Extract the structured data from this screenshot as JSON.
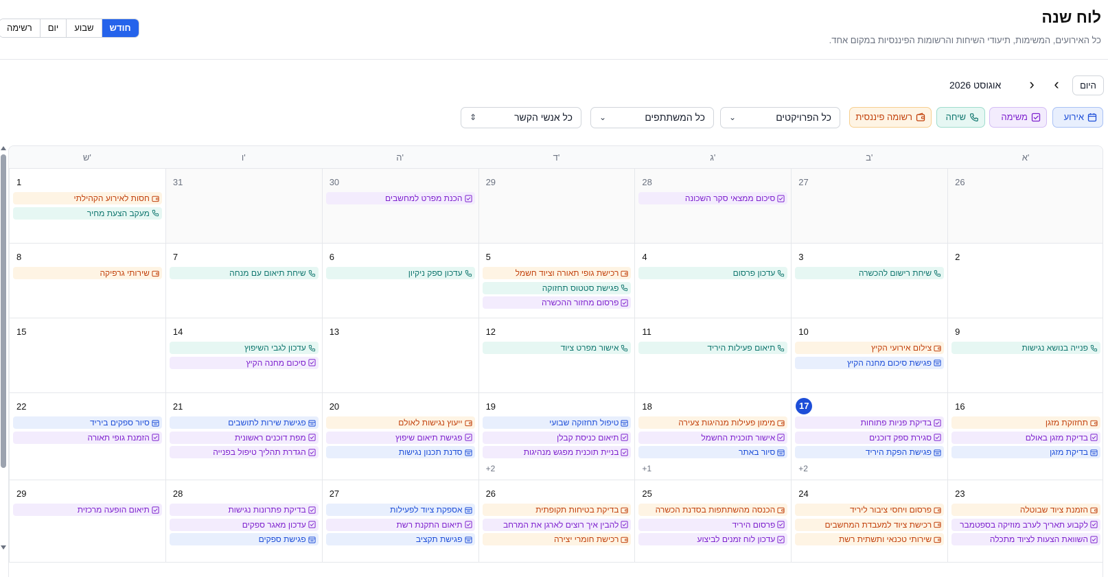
{
  "header": {
    "title": "לוח שנה",
    "subtitle": "כל האירועים, המשימות, תיעודי השיחות והרשומות הפיננסיות במקום אחד."
  },
  "views": [
    "חודש",
    "שבוע",
    "יום",
    "רשימה"
  ],
  "active_view": "חודש",
  "nav": {
    "today_label": "היום",
    "month_label": "אוגוסט 2026"
  },
  "types": {
    "event": "אירוע",
    "task": "משימה",
    "call": "שיחה",
    "fin": "רשומה פיננסית"
  },
  "filters": {
    "projects": "כל הפרויקטים",
    "participants": "כל המשתתפים",
    "contacts": "כל אנשי הקשר"
  },
  "weekdays": [
    "א'",
    "ב'",
    "ג'",
    "ד'",
    "ה'",
    "ו'",
    "ש'"
  ],
  "colors": {
    "event": "#1d4ed8",
    "task": "#7e22ce",
    "call": "#0f766e",
    "fin": "#c2410c",
    "accent": "#2563eb"
  },
  "today": "17",
  "weeks": [
    [
      {
        "day": "26",
        "other": true,
        "events": []
      },
      {
        "day": "27",
        "other": true,
        "events": []
      },
      {
        "day": "28",
        "other": true,
        "events": [
          {
            "t": "task",
            "label": "סיכום ממצאי סקר השכונה"
          }
        ]
      },
      {
        "day": "29",
        "other": true,
        "events": []
      },
      {
        "day": "30",
        "other": true,
        "events": [
          {
            "t": "task",
            "label": "הכנת מפרט למחשבים"
          }
        ]
      },
      {
        "day": "31",
        "other": true,
        "events": []
      },
      {
        "day": "1",
        "events": [
          {
            "t": "fin",
            "label": "חסות לאירוע הקהילתי"
          },
          {
            "t": "call",
            "label": "מעקב הצעת מחיר"
          }
        ]
      }
    ],
    [
      {
        "day": "2",
        "events": []
      },
      {
        "day": "3",
        "events": [
          {
            "t": "call",
            "label": "שיחת רישום להכשרה"
          }
        ]
      },
      {
        "day": "4",
        "events": [
          {
            "t": "call",
            "label": "עדכון פרסום"
          }
        ]
      },
      {
        "day": "5",
        "events": [
          {
            "t": "fin",
            "label": "רכישת גופי תאורה וציוד חשמל"
          },
          {
            "t": "call",
            "label": "פגישת סטטוס תחזוקה"
          },
          {
            "t": "task",
            "label": "פרסום מחזור ההכשרה"
          }
        ]
      },
      {
        "day": "6",
        "events": [
          {
            "t": "call",
            "label": "עדכון ספק ניקיון"
          }
        ]
      },
      {
        "day": "7",
        "events": [
          {
            "t": "call",
            "label": "שיחת תיאום עם מנחה"
          }
        ]
      },
      {
        "day": "8",
        "events": [
          {
            "t": "fin",
            "label": "שירותי גרפיקה"
          }
        ]
      }
    ],
    [
      {
        "day": "9",
        "events": [
          {
            "t": "call",
            "label": "פנייה בנושא נגישות"
          }
        ]
      },
      {
        "day": "10",
        "events": [
          {
            "t": "fin",
            "label": "צילום אירועי הקיץ"
          },
          {
            "t": "event",
            "label": "פגישת סיכום מחנה הקיץ"
          }
        ]
      },
      {
        "day": "11",
        "events": [
          {
            "t": "call",
            "label": "תיאום פעילות היריד"
          }
        ]
      },
      {
        "day": "12",
        "events": [
          {
            "t": "call",
            "label": "אישור מפרט ציוד"
          }
        ]
      },
      {
        "day": "13",
        "events": []
      },
      {
        "day": "14",
        "events": [
          {
            "t": "call",
            "label": "עדכון לגבי השיפוץ"
          },
          {
            "t": "task",
            "label": "סיכום מחנה הקיץ"
          }
        ]
      },
      {
        "day": "15",
        "events": []
      }
    ],
    [
      {
        "day": "16",
        "events": [
          {
            "t": "fin",
            "label": "תחזוקת מזגן"
          },
          {
            "t": "task",
            "label": "בדיקת מזגן באולם"
          },
          {
            "t": "event",
            "label": "בדיקת מזגן"
          }
        ]
      },
      {
        "day": "17",
        "events": [
          {
            "t": "task",
            "label": "בדיקת פניות פתוחות"
          },
          {
            "t": "task",
            "label": "סגירת ספק דוכנים"
          },
          {
            "t": "event",
            "label": "פגישת הפקת היריד"
          }
        ],
        "more": "+2"
      },
      {
        "day": "18",
        "events": [
          {
            "t": "fin",
            "label": "מימון פעילות מנהיגות צעירה"
          },
          {
            "t": "task",
            "label": "אישור תוכנית החשמל"
          },
          {
            "t": "event",
            "label": "סיור באתר"
          }
        ],
        "more": "+1"
      },
      {
        "day": "19",
        "events": [
          {
            "t": "event",
            "label": "טיפול תחזוקה שבועי"
          },
          {
            "t": "task",
            "label": "תיאום כניסת קבלן"
          },
          {
            "t": "task",
            "label": "בניית תוכנית מפגש מנהיגות"
          }
        ],
        "more": "+2"
      },
      {
        "day": "20",
        "events": [
          {
            "t": "fin",
            "label": "ייעוץ נגישות לאולם"
          },
          {
            "t": "task",
            "label": "פגישת תיאום שיפוץ"
          },
          {
            "t": "event",
            "label": "סדנת תכנון נגישות"
          }
        ]
      },
      {
        "day": "21",
        "events": [
          {
            "t": "event",
            "label": "פגישת שירות לתושבים"
          },
          {
            "t": "task",
            "label": "מפת דוכנים ראשונית"
          },
          {
            "t": "task",
            "label": "הגדרת תהליך טיפול בפנייה"
          }
        ]
      },
      {
        "day": "22",
        "events": [
          {
            "t": "event",
            "label": "סיור ספקים ביריד"
          },
          {
            "t": "task",
            "label": "הזמנת גופי תאורה"
          }
        ]
      }
    ],
    [
      {
        "day": "23",
        "events": [
          {
            "t": "fin",
            "label": "הזמנת ציוד שבוטלה"
          },
          {
            "t": "task",
            "label": "לקבוע תאריך לערב מוזיקה בספטמבר"
          },
          {
            "t": "task",
            "label": "השוואת הצעות לציוד מתכלה"
          }
        ]
      },
      {
        "day": "24",
        "events": [
          {
            "t": "fin",
            "label": "פרסום ויחסי ציבור ליריד"
          },
          {
            "t": "fin",
            "label": "רכישת ציוד למעבדת המחשבים"
          },
          {
            "t": "fin",
            "label": "שירותי טכנאי ותשתית רשת"
          }
        ]
      },
      {
        "day": "25",
        "events": [
          {
            "t": "fin",
            "label": "הכנסה מהשתתפות בסדנת הכשרה"
          },
          {
            "t": "task",
            "label": "פרסום היריד"
          },
          {
            "t": "task",
            "label": "עדכון לוח זמנים לביצוע"
          }
        ]
      },
      {
        "day": "26",
        "events": [
          {
            "t": "fin",
            "label": "בדיקת בטיחות תקופתית"
          },
          {
            "t": "task",
            "label": "להבין איך רוצים לארגן את המרחב"
          },
          {
            "t": "fin",
            "label": "רכישת חומרי יצירה"
          }
        ]
      },
      {
        "day": "27",
        "events": [
          {
            "t": "event",
            "label": "אספקת ציוד לפעילות"
          },
          {
            "t": "task",
            "label": "תיאום התקנת רשת"
          },
          {
            "t": "event",
            "label": "פגישת תקציב"
          }
        ]
      },
      {
        "day": "28",
        "events": [
          {
            "t": "task",
            "label": "בדיקת פתרונות נגישות"
          },
          {
            "t": "task",
            "label": "עדכון מאגר ספקים"
          },
          {
            "t": "event",
            "label": "פגישת ספקים"
          }
        ]
      },
      {
        "day": "29",
        "events": [
          {
            "t": "task",
            "label": "תיאום הופעה מרכזית"
          }
        ]
      }
    ]
  ]
}
